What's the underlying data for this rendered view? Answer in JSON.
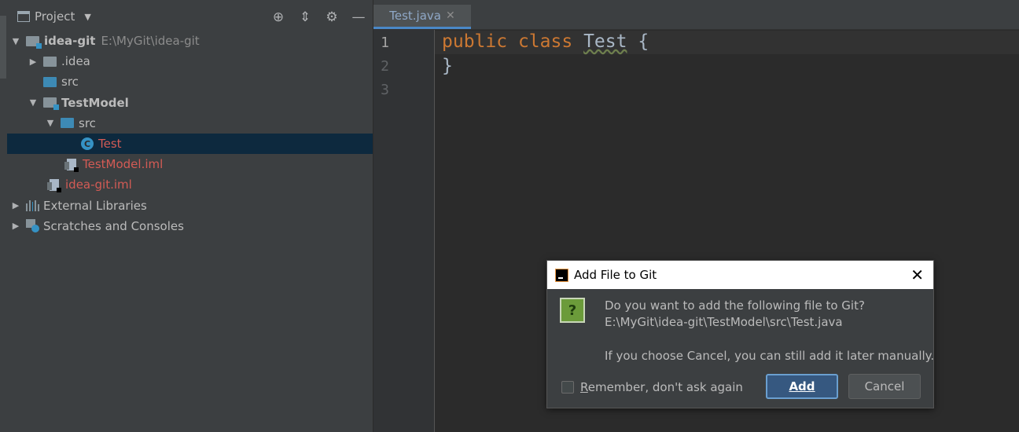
{
  "project_panel": {
    "title": "Project",
    "tree": [
      {
        "label": "idea-git",
        "path": "E:\\MyGit\\idea-git"
      },
      {
        "label": ".idea"
      },
      {
        "label": "src"
      },
      {
        "label": "TestModel"
      },
      {
        "label": "src"
      },
      {
        "label": "Test"
      },
      {
        "label": "TestModel.iml"
      },
      {
        "label": "idea-git.iml"
      },
      {
        "label": "External Libraries"
      },
      {
        "label": "Scratches and Consoles"
      }
    ]
  },
  "editor": {
    "tab_label": "Test.java",
    "line_numbers": [
      "1",
      "2",
      "3"
    ],
    "code": {
      "kw1": "public",
      "kw2": "class",
      "classname": "Test",
      "open_brace": "{",
      "close_brace": "}"
    }
  },
  "dialog": {
    "title": "Add File to Git",
    "question_mark": "?",
    "line1": "Do you want to add the following file to Git?",
    "line2": "E:\\MyGit\\idea-git\\TestModel\\src\\Test.java",
    "line3": "If you choose Cancel, you can still add it later manually.",
    "remember_underlined": "R",
    "remember_rest": "emember, don't ask again",
    "add_label": "Add",
    "cancel_label": "Cancel"
  }
}
